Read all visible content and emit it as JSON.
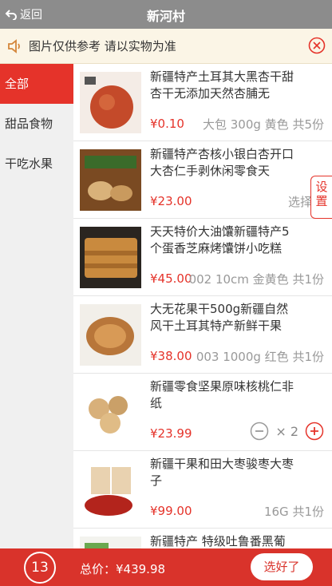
{
  "header": {
    "back_label": "返回",
    "title": "新河村"
  },
  "notice": {
    "text": "图片仅供参考 请以实物为准"
  },
  "categories": [
    {
      "label": "全部",
      "active": true
    },
    {
      "label": "甜品食物",
      "active": false
    },
    {
      "label": "干吃水果",
      "active": false
    }
  ],
  "products": [
    {
      "name": "新疆特产土耳其大黑杏干甜杏干无添加天然杏脯无",
      "price": "¥0.10",
      "spec": "大包 300g 黄色 共5份"
    },
    {
      "name": "新疆特产杏核小银白杏开口大杏仁手剥休闲零食天",
      "price": "¥23.00",
      "spec": "选择类"
    },
    {
      "name": "天天特价大油馕新疆特产5个蛋香芝麻烤馕饼小吃糕",
      "price": "¥45.00",
      "spec": "002 10cm 金黄色 共1份"
    },
    {
      "name": "大无花果干500g新疆自然风干土耳其特产新鲜干果",
      "price": "¥38.00",
      "spec": "003 1000g 红色 共1份"
    },
    {
      "name": "新疆零食坚果原味核桃仁非纸",
      "price": "¥23.99",
      "quantity": "× 2"
    },
    {
      "name": "新疆干果和田大枣骏枣大枣子",
      "price": "¥99.00",
      "spec": "16G 共1份"
    },
    {
      "name": "新疆特产 特级吐鲁番黑葡",
      "price": "",
      "spec": ""
    }
  ],
  "settings_tab": "设置",
  "cart": {
    "count": "13",
    "total": "总价：¥439.98",
    "confirm_label": "选好了"
  },
  "colors": {
    "accent": "#e5332a",
    "header_bg": "#8c8c8c",
    "notice_bg": "#fbf5e6"
  }
}
